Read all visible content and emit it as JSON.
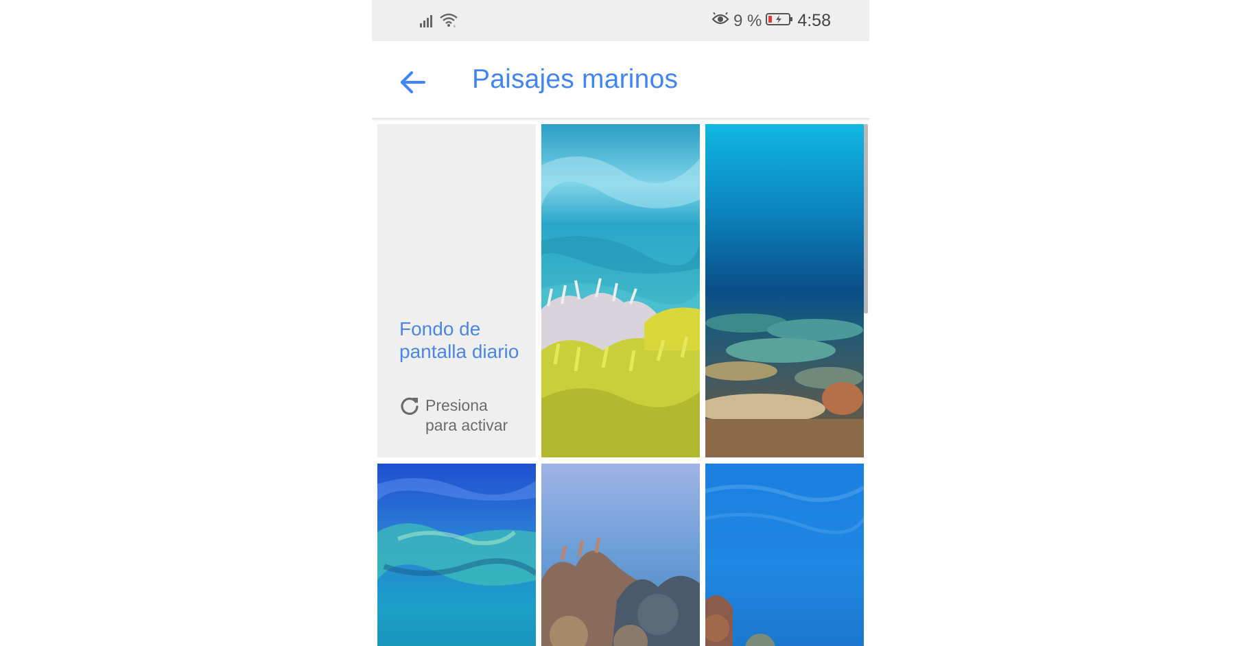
{
  "status_bar": {
    "icons": [
      "signal-icon",
      "wifi-icon",
      "eye-comfort-icon",
      "battery-low-icon"
    ],
    "battery_percent": "9 %",
    "time": "4:58"
  },
  "app_bar": {
    "back_icon": "arrow-left-icon",
    "title": "Paisajes marinos"
  },
  "daily_wallpaper": {
    "title": "Fondo de pantalla diario",
    "subtitle": "Presiona para activar",
    "icon": "refresh-icon"
  },
  "wallpapers": [
    {
      "name": "coral-reef-shallow",
      "scene": "turquoise surface, white and yellow corals"
    },
    {
      "name": "deep-blue-reef",
      "scene": "deep blue water over table corals"
    },
    {
      "name": "blue-surface-reef",
      "scene": "blue surface with green reef below"
    },
    {
      "name": "light-blue-coral",
      "scene": "pale blue water over brown corals"
    },
    {
      "name": "open-blue-water",
      "scene": "bright blue water with coral at bottom"
    }
  ],
  "colors": {
    "accent": "#4285f4",
    "status_bar_bg": "#efefef",
    "daily_tile_bg": "#efefef",
    "battery_low": "#e53935"
  }
}
